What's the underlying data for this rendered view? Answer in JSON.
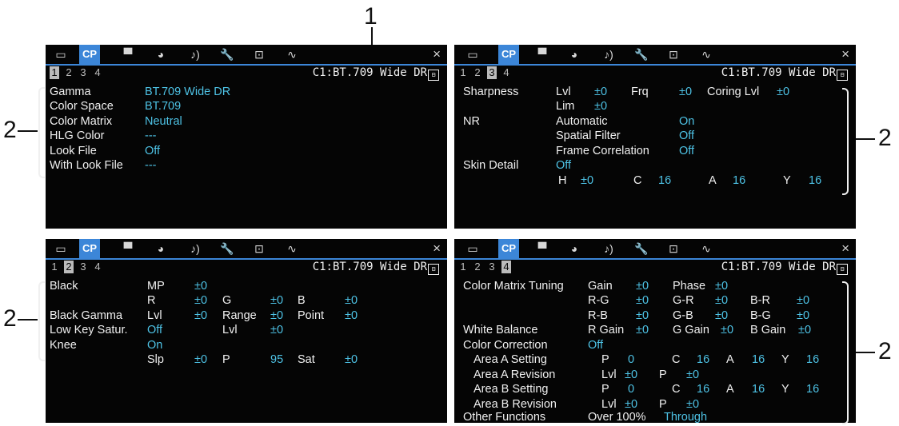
{
  "callouts": {
    "one": "1",
    "two": "2"
  },
  "tabs": [
    {
      "name": "tab-display",
      "icon": "▭",
      "active": false
    },
    {
      "name": "tab-cp",
      "icon": "CP",
      "active": true
    },
    {
      "name": "tab-camera",
      "icon": "▝▘",
      "active": false
    },
    {
      "name": "tab-recording",
      "icon": "◕",
      "active": false
    },
    {
      "name": "tab-audio",
      "icon": "♪)",
      "active": false
    },
    {
      "name": "tab-system",
      "icon": "🔧",
      "active": false
    },
    {
      "name": "tab-assign",
      "icon": "⊡",
      "active": false
    },
    {
      "name": "tab-network",
      "icon": "∿",
      "active": false
    }
  ],
  "close_icon": "×",
  "header": {
    "cp_file": "C1:BT.709 Wide DR",
    "lock_symbol": "⊟"
  },
  "pages": [
    "1",
    "2",
    "3",
    "4"
  ],
  "panel1": {
    "active_page": "1",
    "rows": [
      {
        "label": "Gamma",
        "value": "BT.709 Wide DR"
      },
      {
        "label": "Color Space",
        "value": "BT.709"
      },
      {
        "label": "Color Matrix",
        "value": "Neutral"
      },
      {
        "label": "HLG Color",
        "value": "---"
      },
      {
        "label": "Look File",
        "value": "Off"
      },
      {
        "label": "With Look File",
        "value": "---"
      }
    ]
  },
  "panel2": {
    "active_page": "2",
    "black": "Black",
    "mp": "MP",
    "mp_v": "±0",
    "r": "R",
    "r_v": "±0",
    "g": "G",
    "g_v": "±0",
    "b": "B",
    "b_v": "±0",
    "black_gamma": "Black Gamma",
    "bg_lvl": "Lvl",
    "bg_lvl_v": "±0",
    "bg_range": "Range",
    "bg_range_v": "±0",
    "bg_point": "Point",
    "bg_point_v": "±0",
    "low_key": "Low Key Satur.",
    "low_key_v": "Off",
    "lk_lvl": "Lvl",
    "lk_lvl_v": "±0",
    "knee": "Knee",
    "knee_v": "On",
    "slp": "Slp",
    "slp_v": "±0",
    "p": "P",
    "p_v": "95",
    "sat": "Sat",
    "sat_v": "±0"
  },
  "panel3": {
    "active_page": "3",
    "sharpness": "Sharpness",
    "lvl": "Lvl",
    "lvl_v": "±0",
    "frq": "Frq",
    "frq_v": "±0",
    "coring": "Coring Lvl",
    "coring_v": "±0",
    "lim": "Lim",
    "lim_v": "±0",
    "nr": "NR",
    "automatic": "Automatic",
    "automatic_v": "On",
    "spatial": "Spatial Filter",
    "spatial_v": "Off",
    "frame": "Frame Correlation",
    "frame_v": "Off",
    "skin": "Skin Detail",
    "skin_v": "Off",
    "h": "H",
    "h_v": "±0",
    "c": "C",
    "c_v": "16",
    "a": "A",
    "a_v": "16",
    "y": "Y",
    "y_v": "16"
  },
  "panel4": {
    "active_page": "4",
    "cmt": "Color Matrix Tuning",
    "gain": "Gain",
    "gain_v": "±0",
    "phase": "Phase",
    "phase_v": "±0",
    "rg": "R-G",
    "rg_v": "±0",
    "gr": "G-R",
    "gr_v": "±0",
    "br": "B-R",
    "br_v": "±0",
    "rb": "R-B",
    "rb_v": "±0",
    "gb": "G-B",
    "gb_v": "±0",
    "bg": "B-G",
    "bg_v": "±0",
    "wb": "White Balance",
    "rgain": "R Gain",
    "rgain_v": "±0",
    "ggain": "G Gain",
    "ggain_v": "±0",
    "bgain": "B Gain",
    "bgain_v": "±0",
    "cc": "Color Correction",
    "cc_v": "Off",
    "aas": "Area A Setting",
    "aas_p": "P",
    "aas_p_v": "0",
    "aas_c": "C",
    "aas_c_v": "16",
    "aas_a": "A",
    "aas_a_v": "16",
    "aas_y": "Y",
    "aas_y_v": "16",
    "aar": "Area A Revision",
    "aar_l": "Lvl",
    "aar_l_v": "±0",
    "aar_p": "P",
    "aar_p_v": "±0",
    "abs": "Area B Setting",
    "abs_p": "P",
    "abs_p_v": "0",
    "abs_c": "C",
    "abs_c_v": "16",
    "abs_a": "A",
    "abs_a_v": "16",
    "abs_y": "Y",
    "abs_y_v": "16",
    "abr": "Area B Revision",
    "abr_l": "Lvl",
    "abr_l_v": "±0",
    "abr_p": "P",
    "abr_p_v": "±0",
    "other": "Other Functions",
    "over": "Over 100%",
    "over_v": "Through"
  }
}
